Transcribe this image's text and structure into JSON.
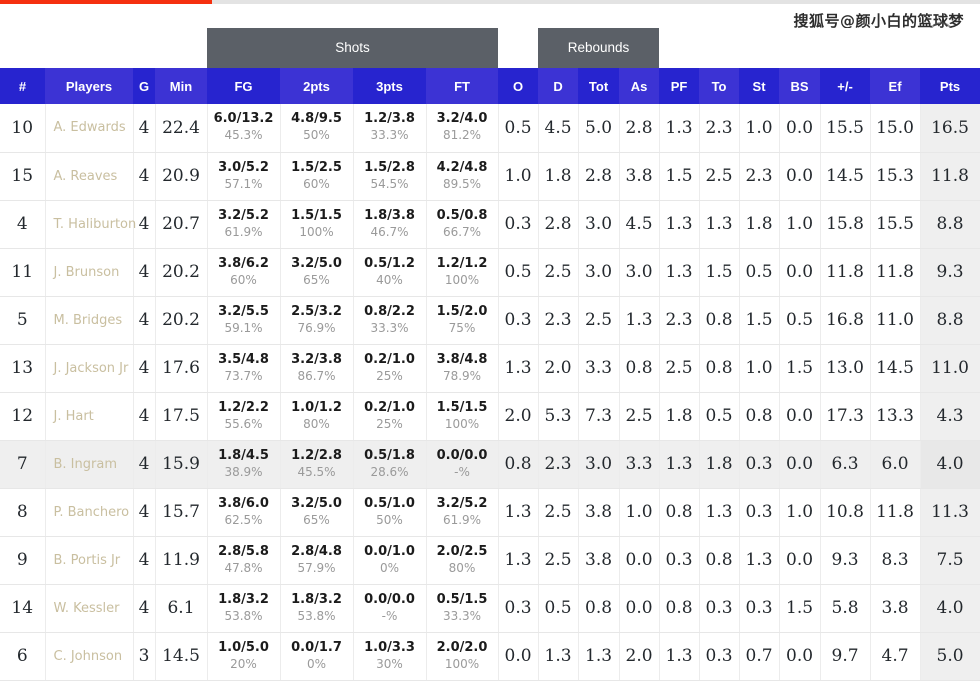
{
  "topbar": {
    "progress_percent": 21.6,
    "fill_color": "#f5300f",
    "track_color": "#e3e3e3"
  },
  "watermark": {
    "text": "搜狐号@颜小白的篮球梦"
  },
  "theme": {
    "header_blue": "#2724cf",
    "header_blue_alt": "#3c33d4",
    "group_gray": "#5b6067",
    "player_name_color": "#c9bfa0",
    "pts_col_bg": "#efefef",
    "highlight_row_bg": "#efefef"
  },
  "table": {
    "group_headers": [
      {
        "label": "",
        "span": 4
      },
      {
        "label": "Shots",
        "span": 4
      },
      {
        "label": "",
        "span": 0
      },
      {
        "label": "Rebounds",
        "span": 3
      }
    ],
    "group_shots_label": "Shots",
    "group_rebounds_label": "Rebounds",
    "columns": [
      "#",
      "Players",
      "G",
      "Min",
      "FG",
      "2pts",
      "3pts",
      "FT",
      "O",
      "D",
      "Tot",
      "As",
      "PF",
      "To",
      "St",
      "BS",
      "+/-",
      "Ef",
      "Pts"
    ],
    "rows": [
      {
        "num": "10",
        "player": "A. Edwards",
        "g": "4",
        "min": "22.4",
        "fg": "6.0/13.2",
        "fg_pct": "45.3%",
        "p2": "4.8/9.5",
        "p2_pct": "50%",
        "p3": "1.2/3.8",
        "p3_pct": "33.3%",
        "ft": "3.2/4.0",
        "ft_pct": "81.2%",
        "o": "0.5",
        "d": "4.5",
        "tot": "5.0",
        "as": "2.8",
        "pf": "1.3",
        "to": "2.3",
        "st": "1.0",
        "bs": "0.0",
        "pm": "15.5",
        "ef": "15.0",
        "pts": "16.5",
        "highlight": false
      },
      {
        "num": "15",
        "player": "A. Reaves",
        "g": "4",
        "min": "20.9",
        "fg": "3.0/5.2",
        "fg_pct": "57.1%",
        "p2": "1.5/2.5",
        "p2_pct": "60%",
        "p3": "1.5/2.8",
        "p3_pct": "54.5%",
        "ft": "4.2/4.8",
        "ft_pct": "89.5%",
        "o": "1.0",
        "d": "1.8",
        "tot": "2.8",
        "as": "3.8",
        "pf": "1.5",
        "to": "2.5",
        "st": "2.3",
        "bs": "0.0",
        "pm": "14.5",
        "ef": "15.3",
        "pts": "11.8",
        "highlight": false
      },
      {
        "num": "4",
        "player": "T. Haliburton",
        "g": "4",
        "min": "20.7",
        "fg": "3.2/5.2",
        "fg_pct": "61.9%",
        "p2": "1.5/1.5",
        "p2_pct": "100%",
        "p3": "1.8/3.8",
        "p3_pct": "46.7%",
        "ft": "0.5/0.8",
        "ft_pct": "66.7%",
        "o": "0.3",
        "d": "2.8",
        "tot": "3.0",
        "as": "4.5",
        "pf": "1.3",
        "to": "1.3",
        "st": "1.8",
        "bs": "1.0",
        "pm": "15.8",
        "ef": "15.5",
        "pts": "8.8",
        "highlight": false
      },
      {
        "num": "11",
        "player": "J. Brunson",
        "g": "4",
        "min": "20.2",
        "fg": "3.8/6.2",
        "fg_pct": "60%",
        "p2": "3.2/5.0",
        "p2_pct": "65%",
        "p3": "0.5/1.2",
        "p3_pct": "40%",
        "ft": "1.2/1.2",
        "ft_pct": "100%",
        "o": "0.5",
        "d": "2.5",
        "tot": "3.0",
        "as": "3.0",
        "pf": "1.3",
        "to": "1.5",
        "st": "0.5",
        "bs": "0.0",
        "pm": "11.8",
        "ef": "11.8",
        "pts": "9.3",
        "highlight": false
      },
      {
        "num": "5",
        "player": "M. Bridges",
        "g": "4",
        "min": "20.2",
        "fg": "3.2/5.5",
        "fg_pct": "59.1%",
        "p2": "2.5/3.2",
        "p2_pct": "76.9%",
        "p3": "0.8/2.2",
        "p3_pct": "33.3%",
        "ft": "1.5/2.0",
        "ft_pct": "75%",
        "o": "0.3",
        "d": "2.3",
        "tot": "2.5",
        "as": "1.3",
        "pf": "2.3",
        "to": "0.8",
        "st": "1.5",
        "bs": "0.5",
        "pm": "16.8",
        "ef": "11.0",
        "pts": "8.8",
        "highlight": false
      },
      {
        "num": "13",
        "player": "J. Jackson Jr",
        "g": "4",
        "min": "17.6",
        "fg": "3.5/4.8",
        "fg_pct": "73.7%",
        "p2": "3.2/3.8",
        "p2_pct": "86.7%",
        "p3": "0.2/1.0",
        "p3_pct": "25%",
        "ft": "3.8/4.8",
        "ft_pct": "78.9%",
        "o": "1.3",
        "d": "2.0",
        "tot": "3.3",
        "as": "0.8",
        "pf": "2.5",
        "to": "0.8",
        "st": "1.0",
        "bs": "1.5",
        "pm": "13.0",
        "ef": "14.5",
        "pts": "11.0",
        "highlight": false
      },
      {
        "num": "12",
        "player": "J. Hart",
        "g": "4",
        "min": "17.5",
        "fg": "1.2/2.2",
        "fg_pct": "55.6%",
        "p2": "1.0/1.2",
        "p2_pct": "80%",
        "p3": "0.2/1.0",
        "p3_pct": "25%",
        "ft": "1.5/1.5",
        "ft_pct": "100%",
        "o": "2.0",
        "d": "5.3",
        "tot": "7.3",
        "as": "2.5",
        "pf": "1.8",
        "to": "0.5",
        "st": "0.8",
        "bs": "0.0",
        "pm": "17.3",
        "ef": "13.3",
        "pts": "4.3",
        "highlight": false
      },
      {
        "num": "7",
        "player": "B. Ingram",
        "g": "4",
        "min": "15.9",
        "fg": "1.8/4.5",
        "fg_pct": "38.9%",
        "p2": "1.2/2.8",
        "p2_pct": "45.5%",
        "p3": "0.5/1.8",
        "p3_pct": "28.6%",
        "ft": "0.0/0.0",
        "ft_pct": "-%",
        "o": "0.8",
        "d": "2.3",
        "tot": "3.0",
        "as": "3.3",
        "pf": "1.3",
        "to": "1.8",
        "st": "0.3",
        "bs": "0.0",
        "pm": "6.3",
        "ef": "6.0",
        "pts": "4.0",
        "highlight": true
      },
      {
        "num": "8",
        "player": "P. Banchero",
        "g": "4",
        "min": "15.7",
        "fg": "3.8/6.0",
        "fg_pct": "62.5%",
        "p2": "3.2/5.0",
        "p2_pct": "65%",
        "p3": "0.5/1.0",
        "p3_pct": "50%",
        "ft": "3.2/5.2",
        "ft_pct": "61.9%",
        "o": "1.3",
        "d": "2.5",
        "tot": "3.8",
        "as": "1.0",
        "pf": "0.8",
        "to": "1.3",
        "st": "0.3",
        "bs": "1.0",
        "pm": "10.8",
        "ef": "11.8",
        "pts": "11.3",
        "highlight": false
      },
      {
        "num": "9",
        "player": "B. Portis Jr",
        "g": "4",
        "min": "11.9",
        "fg": "2.8/5.8",
        "fg_pct": "47.8%",
        "p2": "2.8/4.8",
        "p2_pct": "57.9%",
        "p3": "0.0/1.0",
        "p3_pct": "0%",
        "ft": "2.0/2.5",
        "ft_pct": "80%",
        "o": "1.3",
        "d": "2.5",
        "tot": "3.8",
        "as": "0.0",
        "pf": "0.3",
        "to": "0.8",
        "st": "1.3",
        "bs": "0.0",
        "pm": "9.3",
        "ef": "8.3",
        "pts": "7.5",
        "highlight": false
      },
      {
        "num": "14",
        "player": "W. Kessler",
        "g": "4",
        "min": "6.1",
        "fg": "1.8/3.2",
        "fg_pct": "53.8%",
        "p2": "1.8/3.2",
        "p2_pct": "53.8%",
        "p3": "0.0/0.0",
        "p3_pct": "-%",
        "ft": "0.5/1.5",
        "ft_pct": "33.3%",
        "o": "0.3",
        "d": "0.5",
        "tot": "0.8",
        "as": "0.0",
        "pf": "0.8",
        "to": "0.3",
        "st": "0.3",
        "bs": "1.5",
        "pm": "5.8",
        "ef": "3.8",
        "pts": "4.0",
        "highlight": false
      },
      {
        "num": "6",
        "player": "C. Johnson",
        "g": "3",
        "min": "14.5",
        "fg": "1.0/5.0",
        "fg_pct": "20%",
        "p2": "0.0/1.7",
        "p2_pct": "0%",
        "p3": "1.0/3.3",
        "p3_pct": "30%",
        "ft": "2.0/2.0",
        "ft_pct": "100%",
        "o": "0.0",
        "d": "1.3",
        "tot": "1.3",
        "as": "2.0",
        "pf": "1.3",
        "to": "0.3",
        "st": "0.7",
        "bs": "0.0",
        "pm": "9.7",
        "ef": "4.7",
        "pts": "5.0",
        "highlight": false
      }
    ]
  }
}
